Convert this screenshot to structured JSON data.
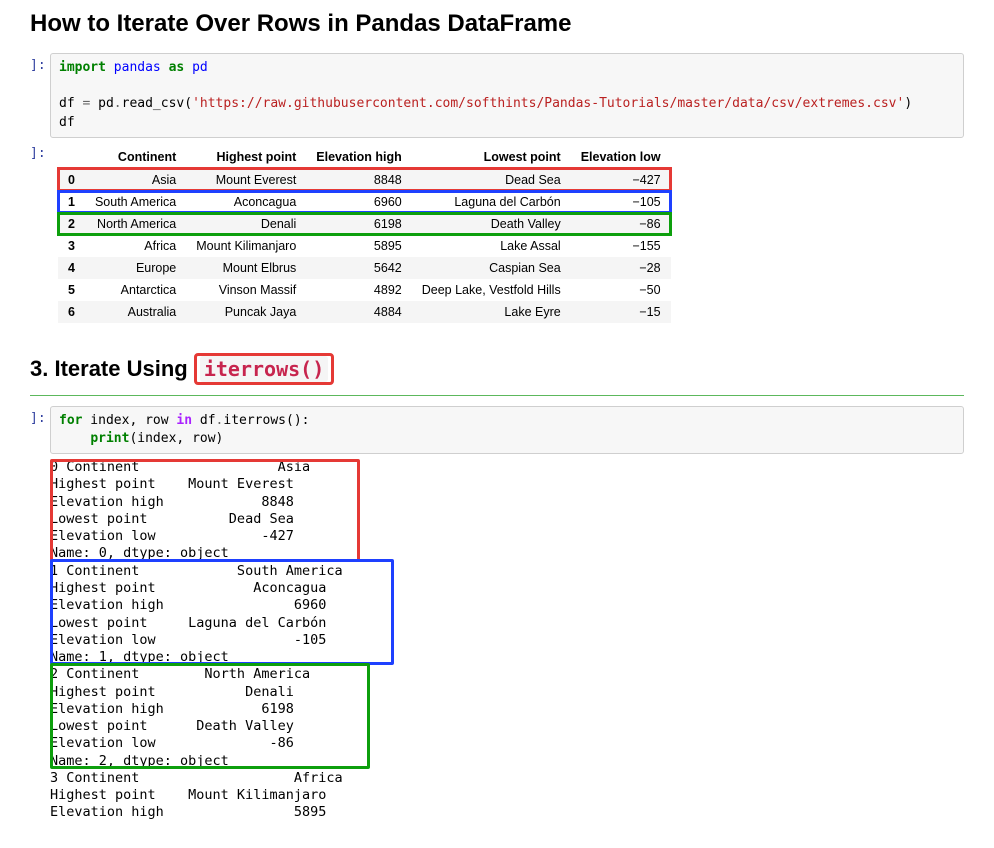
{
  "title": "How to Iterate Over Rows in Pandas DataFrame",
  "prompt": "]:",
  "code1_line1": "<span class='kw-green'>import</span> <span class='kw-blue'>pandas</span> <span class='kw-green'>as</span> <span class='kw-blue'>pd</span>",
  "code1_line2": "df <span class='kw-op'>=</span> pd<span class='kw-op'>.</span>read_csv(<span class='kw-str'>'https://raw.githubusercontent.com/softhints/Pandas-Tutorials/master/data/csv/extremes.csv'</span>)",
  "code1_line3": "df",
  "table": {
    "columns": [
      "Continent",
      "Highest point",
      "Elevation high",
      "Lowest point",
      "Elevation low"
    ],
    "rows": [
      {
        "idx": "0",
        "data": [
          "Asia",
          "Mount Everest",
          "8848",
          "Dead Sea",
          "−427"
        ],
        "hl": "hl-red"
      },
      {
        "idx": "1",
        "data": [
          "South America",
          "Aconcagua",
          "6960",
          "Laguna del Carbón",
          "−105"
        ],
        "hl": "hl-blue"
      },
      {
        "idx": "2",
        "data": [
          "North America",
          "Denali",
          "6198",
          "Death Valley",
          "−86"
        ],
        "hl": "hl-green"
      },
      {
        "idx": "3",
        "data": [
          "Africa",
          "Mount Kilimanjaro",
          "5895",
          "Lake Assal",
          "−155"
        ],
        "hl": ""
      },
      {
        "idx": "4",
        "data": [
          "Europe",
          "Mount Elbrus",
          "5642",
          "Caspian Sea",
          "−28"
        ],
        "hl": ""
      },
      {
        "idx": "5",
        "data": [
          "Antarctica",
          "Vinson Massif",
          "4892",
          "Deep Lake, Vestfold Hills",
          "−50"
        ],
        "hl": ""
      },
      {
        "idx": "6",
        "data": [
          "Australia",
          "Puncak Jaya",
          "4884",
          "Lake Eyre",
          "−15"
        ],
        "hl": ""
      }
    ]
  },
  "section_title_pre": "3. Iterate Using ",
  "section_title_code": "iterrows()",
  "code2": "<span class='kw-green'>for</span> index, row <span class='kw-purple'>in</span> df<span class='kw-op'>.</span>iterrows():\n    <span class='kw-green'>print</span>(index, row)",
  "output_text": "0 Continent                 Asia\nHighest point    Mount Everest\nElevation high            8848\nLowest point          Dead Sea\nElevation low             -427\nName: 0, dtype: object\n1 Continent            South America\nHighest point            Aconcagua\nElevation high                6960\nLowest point     Laguna del Carbón\nElevation low                 -105\nName: 1, dtype: object\n2 Continent        North America\nHighest point           Denali\nElevation high            6198\nLowest point      Death Valley\nElevation low              -86\nName: 2, dtype: object\n3 Continent                   Africa\nHighest point    Mount Kilimanjaro\nElevation high                5895"
}
